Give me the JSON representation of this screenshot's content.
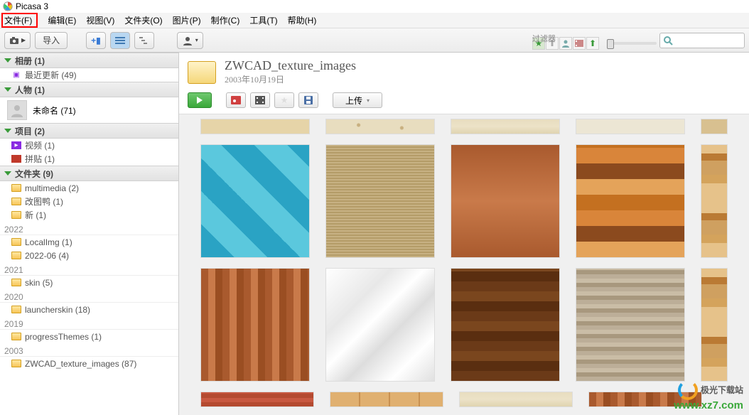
{
  "app": {
    "title": "Picasa 3"
  },
  "menu": {
    "file": "文件(F)",
    "edit": "编辑(E)",
    "view": "视图(V)",
    "folder": "文件夹(O)",
    "picture": "图片(P)",
    "make": "制作(C)",
    "tools": "工具(T)",
    "help": "帮助(H)"
  },
  "toolbar": {
    "import": "导入",
    "filters_label": "过滤器"
  },
  "sidebar": {
    "album": {
      "title": "相册 (1)",
      "items": [
        {
          "label": "最近更新 (49)"
        }
      ]
    },
    "people": {
      "title": "人物 (1)",
      "items": [
        {
          "label": "未命名 (71)"
        }
      ]
    },
    "projects": {
      "title": "项目 (2)",
      "items": [
        {
          "label": "视频 (1)"
        },
        {
          "label": "拼贴 (1)"
        }
      ]
    },
    "folders": {
      "title": "文件夹 (9)",
      "loose": [
        {
          "label": "multimedia (2)"
        },
        {
          "label": "改图鸭 (1)"
        },
        {
          "label": "新 (1)"
        }
      ],
      "groups": [
        {
          "year": "2022",
          "items": [
            {
              "label": "LocalImg (1)"
            },
            {
              "label": "2022-06 (4)"
            }
          ]
        },
        {
          "year": "2021",
          "items": [
            {
              "label": "skin (5)"
            }
          ]
        },
        {
          "year": "2020",
          "items": [
            {
              "label": "launcherskin (18)"
            }
          ]
        },
        {
          "year": "2019",
          "items": [
            {
              "label": "progressThemes (1)"
            }
          ]
        },
        {
          "year": "2003",
          "items": [
            {
              "label": "ZWCAD_texture_images (87)"
            }
          ]
        }
      ]
    }
  },
  "folder": {
    "name": "ZWCAD_texture_images",
    "date": "2003年10月19日"
  },
  "actions": {
    "upload": "上传"
  },
  "watermark": {
    "name": "极光下载站",
    "url": "www.xz7.com"
  }
}
